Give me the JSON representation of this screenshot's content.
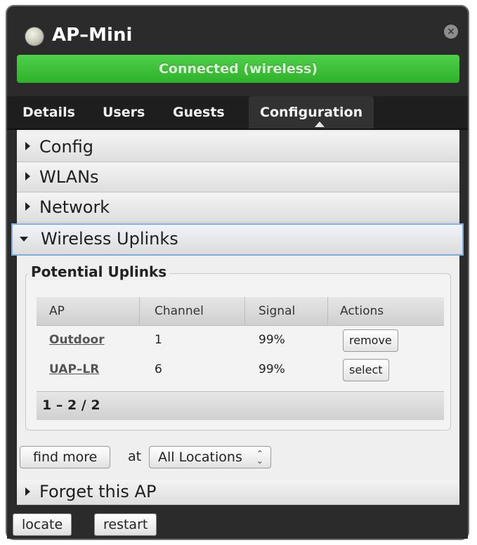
{
  "window": {
    "title": "AP–Mini",
    "status": "Connected (wireless)",
    "status_color": "#3cc139"
  },
  "tabs": [
    {
      "label": "Details"
    },
    {
      "label": "Users"
    },
    {
      "label": "Guests"
    },
    {
      "label": "Configuration",
      "active": true
    }
  ],
  "sections": {
    "config": "Config",
    "wlans": "WLANs",
    "network": "Network",
    "wireless_uplinks": "Wireless Uplinks",
    "forget": "Forget this AP"
  },
  "uplinks": {
    "legend": "Potential Uplinks",
    "columns": [
      "AP",
      "Channel",
      "Signal",
      "Actions"
    ],
    "rows": [
      {
        "ap": "Outdoor",
        "channel": "1",
        "signal": "99%",
        "action": "remove"
      },
      {
        "ap": "UAP–LR",
        "channel": "6",
        "signal": "99%",
        "action": "select"
      }
    ],
    "pager": "1 – 2 / 2"
  },
  "find": {
    "button": "find more",
    "at": "at",
    "location": "All Locations",
    "select_icon": "up-down-chevron-icon"
  },
  "bottom": {
    "locate": "locate",
    "restart": "restart"
  },
  "icons": {
    "logo": "ubiquiti-logo-icon",
    "close": "close-icon",
    "section_collapsed": "triangle-right-icon",
    "section_expanded": "triangle-down-icon"
  }
}
